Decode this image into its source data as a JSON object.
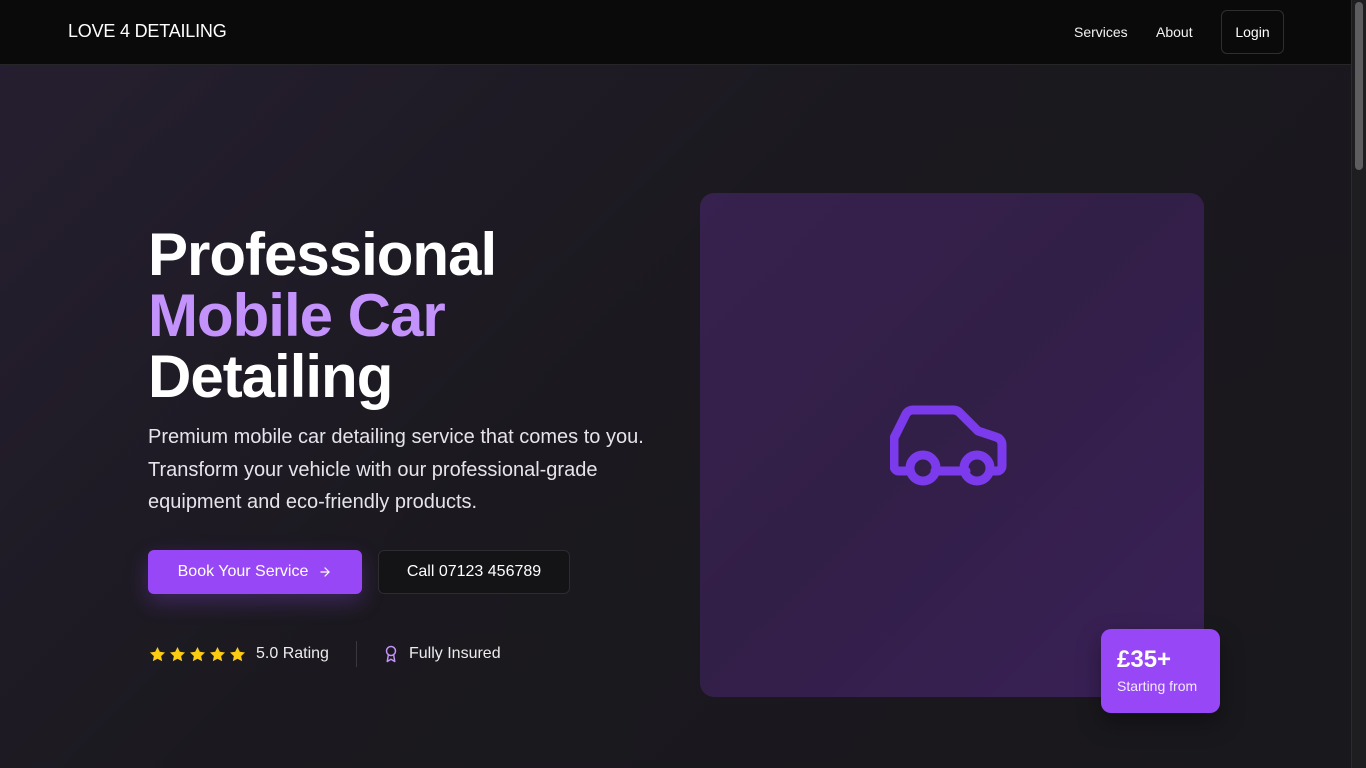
{
  "nav": {
    "brand": "LOVE 4 DETAILING",
    "links": [
      {
        "label": "Services"
      },
      {
        "label": "About"
      }
    ],
    "login_label": "Login"
  },
  "hero": {
    "title_line1": "Professional",
    "title_line2": "Mobile Car",
    "title_line3": "Detailing",
    "description": "Premium mobile car detailing service that comes to you. Transform your vehicle with our professional-grade equipment and eco-friendly products.",
    "primary_button": "Book Your Service",
    "secondary_button": "Call 07123 456789",
    "rating": {
      "stars": 5,
      "label": "5.0 Rating"
    },
    "insured_label": "Fully Insured"
  },
  "card": {
    "icon": "car-icon",
    "price": "£35+",
    "price_caption": "Starting from"
  },
  "colors": {
    "accent": "#9747f5",
    "accent_light": "#c392fb",
    "star": "#facc15",
    "nav_bg": "#0a0a0a"
  }
}
